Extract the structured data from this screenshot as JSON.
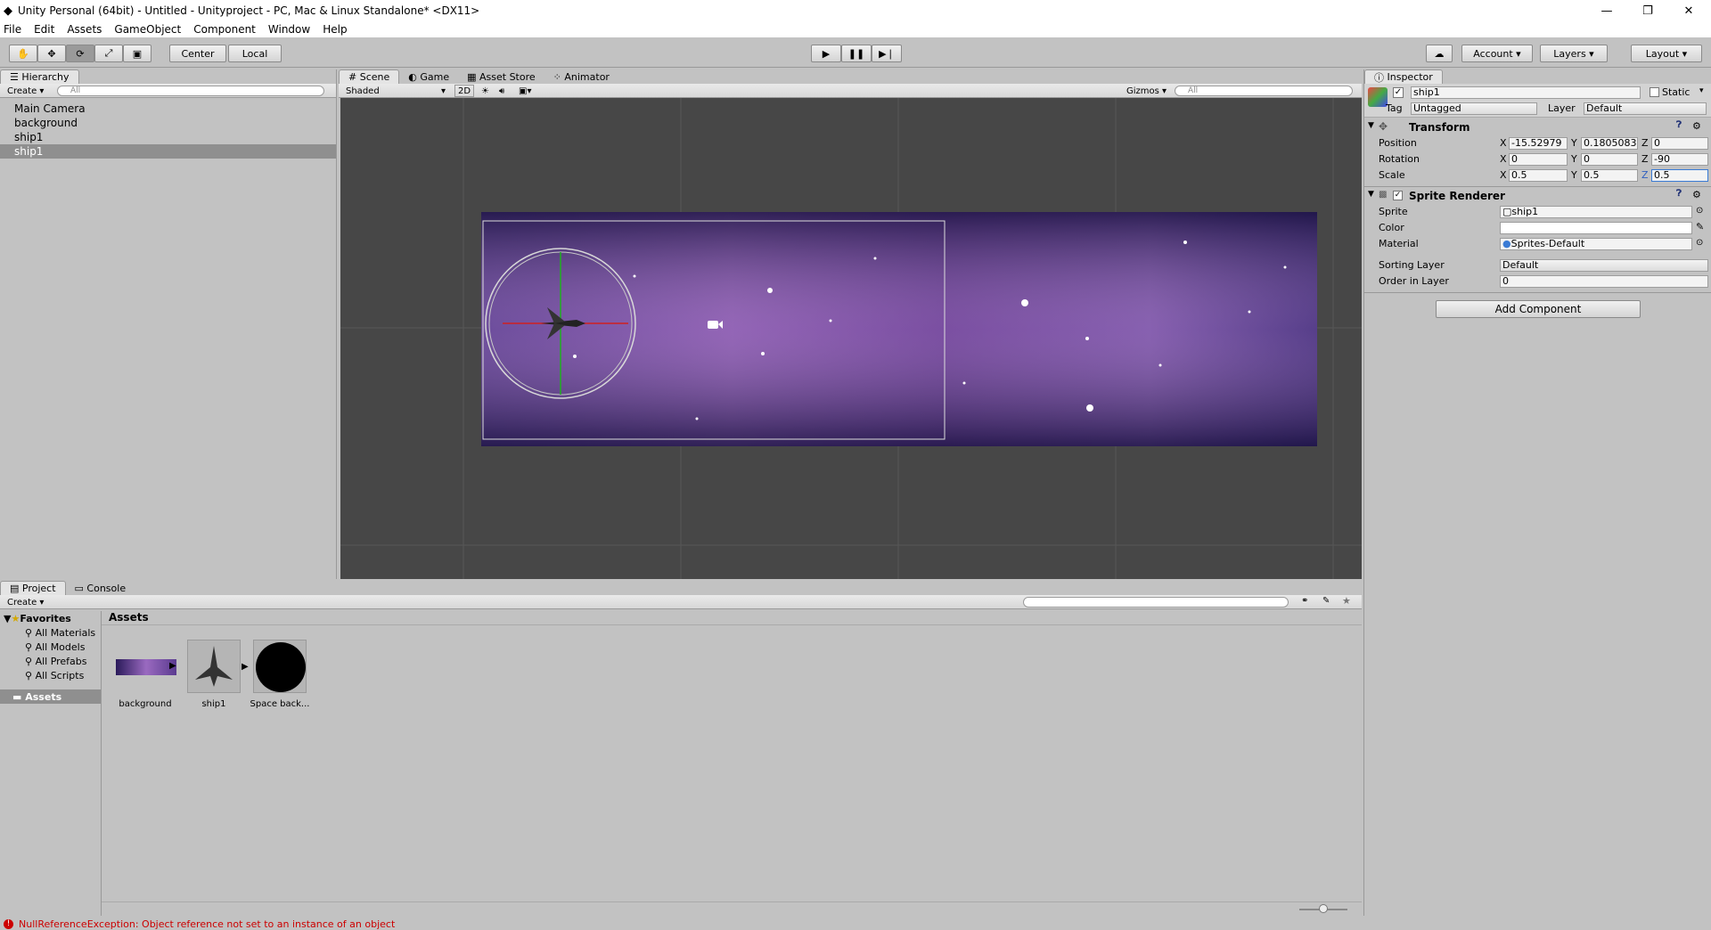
{
  "window": {
    "title": "Unity Personal (64bit) - Untitled - Unityproject - PC, Mac & Linux Standalone* <DX11>"
  },
  "menu": [
    "File",
    "Edit",
    "Assets",
    "GameObject",
    "Component",
    "Window",
    "Help"
  ],
  "toolbar": {
    "center": "Center",
    "local": "Local",
    "account": "Account",
    "layers": "Layers",
    "layout": "Layout"
  },
  "hierarchy": {
    "tab": "Hierarchy",
    "create": "Create",
    "search_placeholder": "All",
    "items": [
      "Main Camera",
      "background",
      "ship1",
      "ship1"
    ]
  },
  "scene": {
    "tabs": [
      "Scene",
      "Game",
      "Asset Store",
      "Animator"
    ],
    "shading": "Shaded",
    "mode2d": "2D",
    "gizmos": "Gizmos",
    "search_placeholder": "All"
  },
  "inspector": {
    "tab": "Inspector",
    "object_name": "ship1",
    "static_label": "Static",
    "tag_label": "Tag",
    "tag_value": "Untagged",
    "layer_label": "Layer",
    "layer_value": "Default",
    "transform": {
      "title": "Transform",
      "position_label": "Position",
      "px": "-15.52979",
      "py": "0.1805083",
      "pz": "0",
      "rotation_label": "Rotation",
      "rx": "0",
      "ry": "0",
      "rz": "-90",
      "scale_label": "Scale",
      "sx": "0.5",
      "sy": "0.5",
      "sz": "0.5"
    },
    "sprite_renderer": {
      "title": "Sprite Renderer",
      "sprite_label": "Sprite",
      "sprite_value": "ship1",
      "color_label": "Color",
      "material_label": "Material",
      "material_value": "Sprites-Default",
      "sorting_label": "Sorting Layer",
      "sorting_value": "Default",
      "order_label": "Order in Layer",
      "order_value": "0"
    },
    "add_component": "Add Component"
  },
  "project": {
    "tabs": [
      "Project",
      "Console"
    ],
    "create": "Create",
    "favorites_label": "Favorites",
    "favorites": [
      "All Materials",
      "All Models",
      "All Prefabs",
      "All Scripts"
    ],
    "assets_folder": "Assets",
    "breadcrumb": "Assets",
    "assets": [
      "background",
      "ship1",
      "Space back..."
    ]
  },
  "status": {
    "message": "NullReferenceException: Object reference not set to an instance of an object"
  },
  "colors": {
    "selection": "#8f8f8f",
    "error": "#cc0000",
    "scene_bg": "#474747"
  }
}
